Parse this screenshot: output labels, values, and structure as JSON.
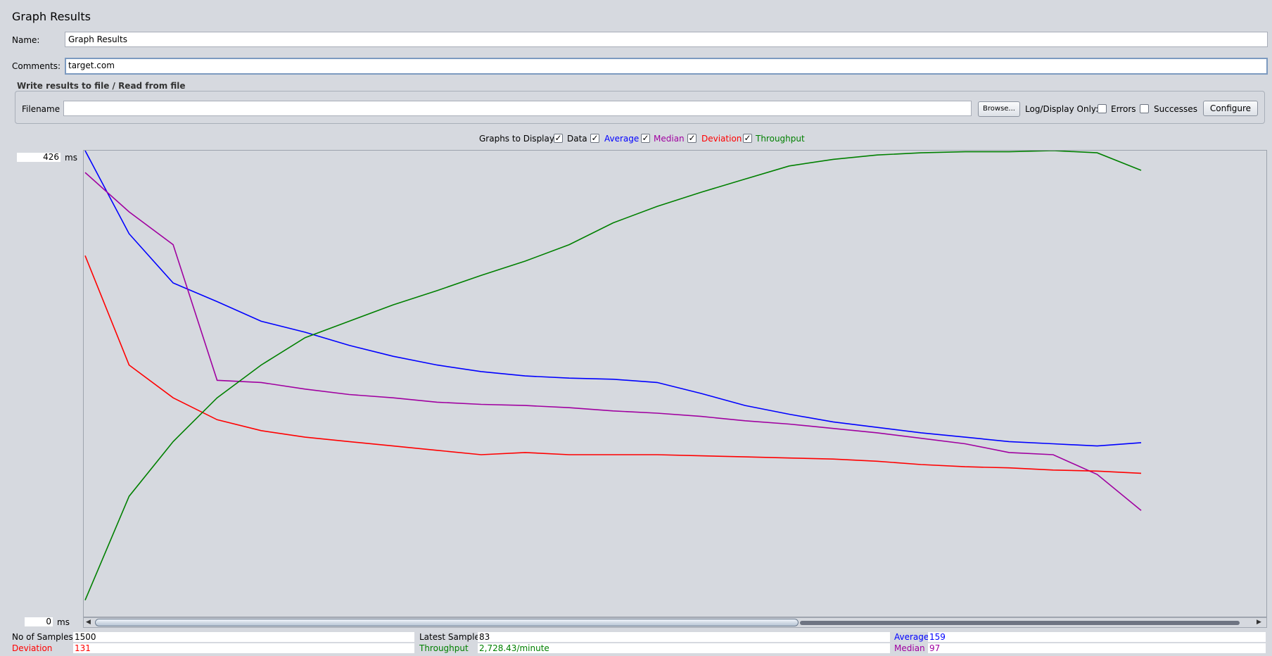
{
  "panel": {
    "title": "Graph Results"
  },
  "form": {
    "name_label": "Name:",
    "name_value": "Graph Results",
    "comments_label": "Comments:",
    "comments_value": "target.com"
  },
  "file_group": {
    "title": "Write results to file / Read from file",
    "filename_label": "Filename",
    "filename_value": "",
    "browse_label": "Browse...",
    "log_display_label": "Log/Display Only:",
    "errors_label": "Errors",
    "errors_checked": false,
    "successes_label": "Successes",
    "successes_checked": false,
    "configure_label": "Configure"
  },
  "graphs_to_display": {
    "label": "Graphs to Display",
    "options": [
      {
        "label": "Data",
        "checked": true,
        "color": "#000000"
      },
      {
        "label": "Average",
        "checked": true,
        "color": "#0000ff"
      },
      {
        "label": "Median",
        "checked": true,
        "color": "#a000a0"
      },
      {
        "label": "Deviation",
        "checked": true,
        "color": "#ff0000"
      },
      {
        "label": "Throughput",
        "checked": true,
        "color": "#008000"
      }
    ]
  },
  "graph": {
    "y_max_value": "426",
    "y_max_unit": "ms",
    "y_min_value": "0",
    "y_min_unit": "ms"
  },
  "chart_data": {
    "type": "line",
    "ylim": [
      0,
      426
    ],
    "y_unit": "ms",
    "x_label": "",
    "series": [
      {
        "name": "Average",
        "color": "#0000ff",
        "values": [
          426,
          350,
          305,
          288,
          270,
          260,
          248,
          238,
          230,
          224,
          220,
          218,
          217,
          214,
          204,
          193,
          185,
          178,
          173,
          168,
          164,
          160,
          158,
          156,
          159
        ]
      },
      {
        "name": "Median",
        "color": "#a000a0",
        "values": [
          406,
          370,
          340,
          216,
          214,
          208,
          203,
          200,
          196,
          194,
          193,
          191,
          188,
          186,
          183,
          179,
          176,
          172,
          168,
          163,
          158,
          150,
          148,
          130,
          97
        ]
      },
      {
        "name": "Deviation",
        "color": "#ff0000",
        "values": [
          330,
          230,
          200,
          180,
          170,
          164,
          160,
          156,
          152,
          148,
          150,
          148,
          148,
          148,
          147,
          146,
          145,
          144,
          142,
          139,
          137,
          136,
          134,
          133,
          131
        ]
      },
      {
        "name": "Throughput",
        "color": "#008000",
        "values": [
          15,
          110,
          160,
          200,
          230,
          255,
          270,
          285,
          298,
          312,
          325,
          340,
          360,
          375,
          388,
          400,
          412,
          418,
          422,
          424,
          425,
          425,
          426,
          424,
          408
        ]
      }
    ]
  },
  "stats": {
    "samples_label": "No of Samples",
    "samples_value": "1500",
    "latest_label": "Latest Sample",
    "latest_value": "83",
    "average_label": "Average",
    "average_value": "159",
    "deviation_label": "Deviation",
    "deviation_value": "131",
    "throughput_label": "Throughput",
    "throughput_value": "2,728.43/minute",
    "median_label": "Median",
    "median_value": "97"
  }
}
